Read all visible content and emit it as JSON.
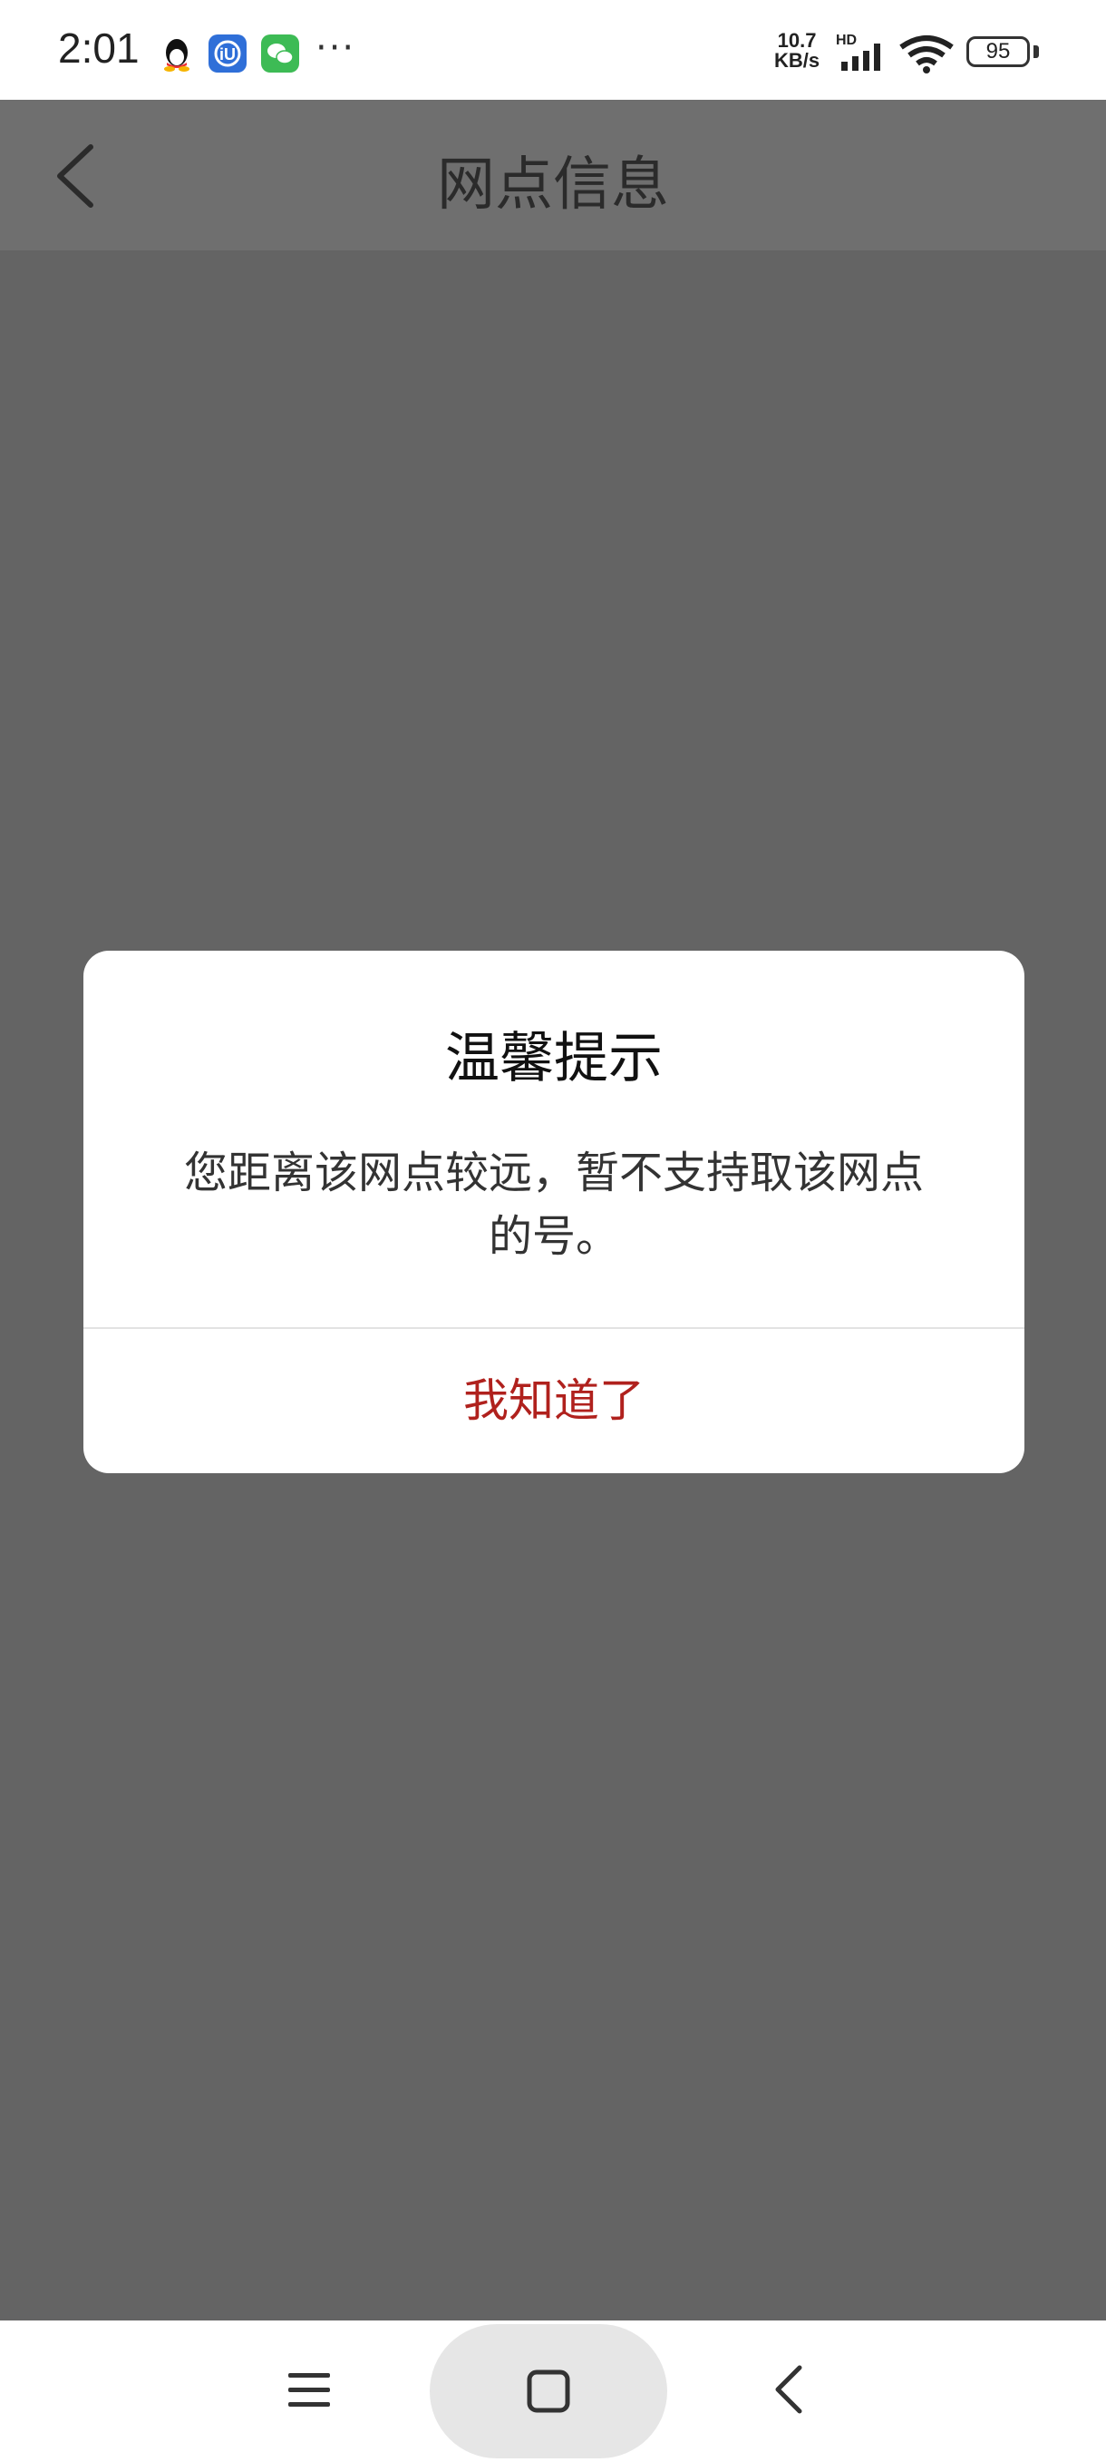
{
  "status_bar": {
    "time": "2:01",
    "net_speed_value": "10.7",
    "net_speed_unit": "KB/s",
    "network_label": "HD",
    "battery": "95",
    "icons": [
      "qq-icon",
      "iu-icon",
      "wechat-icon",
      "more-dots-icon",
      "signal-icon",
      "wifi-icon",
      "battery-icon"
    ]
  },
  "header": {
    "title": "网点信息",
    "back_icon": "chevron-left-icon"
  },
  "dialog": {
    "title": "温馨提示",
    "message": "您距离该网点较远，暂不支持取该网点的号。",
    "confirm_label": "我知道了",
    "accent_color": "#b0211d"
  },
  "nav_bar": {
    "icons": [
      "menu-icon",
      "home-icon",
      "back-icon"
    ]
  },
  "colors": {
    "overlay": "#646464",
    "dialog_bg": "#ffffff"
  }
}
